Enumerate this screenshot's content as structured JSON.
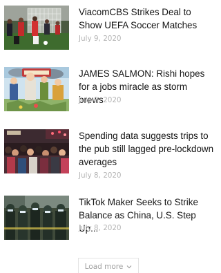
{
  "articles": [
    {
      "title": "ViacomCBS Strikes Deal to Show UEFA Soccer Matches",
      "date": "July 9, 2020",
      "thumbnail_icon": "soccer-match-photo"
    },
    {
      "title": "JAMES SALMON: Rishi hopes for a jobs miracle as storm brews",
      "date": "July 8, 2020",
      "thumbnail_icon": "cartoon-illustration"
    },
    {
      "title": "Spending data suggests trips to the pub still lagged pre-lockdown averages",
      "date": "July 8, 2020",
      "thumbnail_icon": "pub-crowd-photo"
    },
    {
      "title": "TikTok Maker Seeks to Strike Balance as China, U.S. Step Up...",
      "date": "July 8, 2020",
      "thumbnail_icon": "police-line-photo"
    }
  ],
  "load_more": {
    "label": "Load more",
    "icon": "chevron-down-icon"
  },
  "colors": {
    "title": "#141414",
    "date": "#b3b3b3",
    "button_text": "#a0a0a0",
    "button_border": "#e3e3e3"
  }
}
